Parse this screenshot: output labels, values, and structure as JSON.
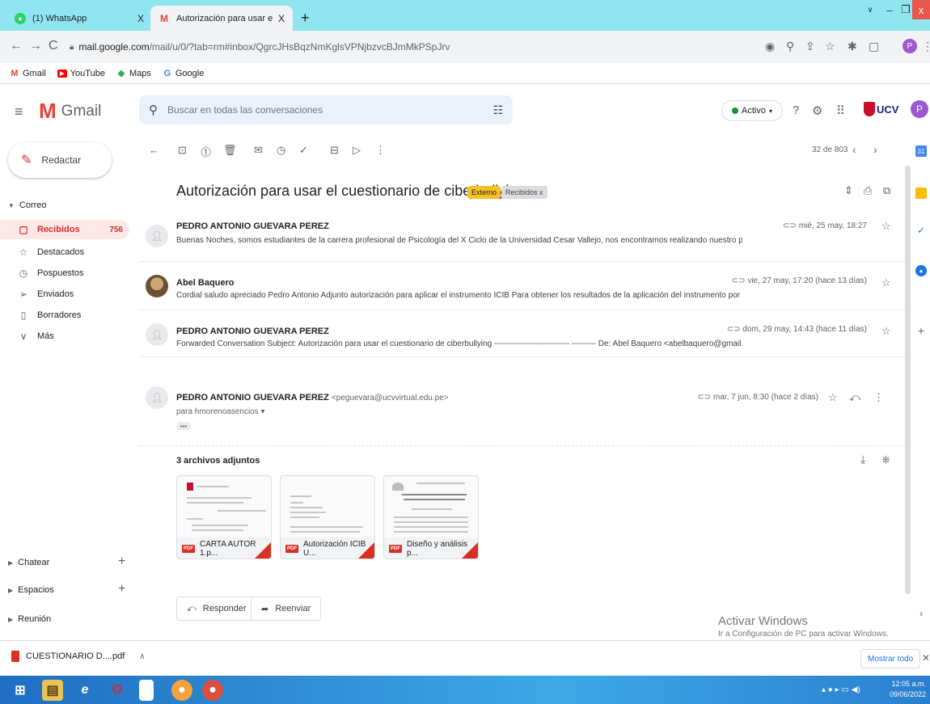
{
  "browser": {
    "tabs": [
      {
        "title": "(1) WhatsApp",
        "icon": "whatsapp-icon",
        "color": "#25d366",
        "glyph": "●"
      },
      {
        "title": "Autorización para usar el cuestion",
        "icon": "gmail-icon",
        "color": "#ea4335",
        "glyph": "M"
      }
    ],
    "new_tab": "+",
    "close_tab": "X",
    "url_host": "mail.google.com",
    "url_path": "/mail/u/0/?tab=rm#inbox/QgrcJHsBqzNmKglsVPNjbzvcBJmMkPSpJrv",
    "profile_initial": "P",
    "bookmarks": [
      {
        "label": "Gmail",
        "icon": "gmail-bookmark-icon",
        "glyph": "M",
        "color": "#ea4335"
      },
      {
        "label": "YouTube",
        "icon": "youtube-bookmark-icon",
        "glyph": "▶",
        "color": "#ff0000"
      },
      {
        "label": "Maps",
        "icon": "maps-bookmark-icon",
        "glyph": "◆",
        "color": "#34a853"
      },
      {
        "label": "Google",
        "icon": "google-bookmark-icon",
        "glyph": "G",
        "color": "#4285f4"
      }
    ]
  },
  "gmail": {
    "app_name": "Gmail",
    "search_placeholder": "Buscar en todas las conversaciones",
    "status": "Activo",
    "profile_initial": "P",
    "org_logo_text": "UCV"
  },
  "sidebar": {
    "compose_label": "Redactar",
    "section_mail": "Correo",
    "items": [
      {
        "label": "Recibidos",
        "count": "756",
        "icon": "inbox-icon",
        "glyph": "▢",
        "active": true
      },
      {
        "label": "Destacados",
        "icon": "star-icon",
        "glyph": "☆"
      },
      {
        "label": "Pospuestos",
        "icon": "clock-icon",
        "glyph": "◷"
      },
      {
        "label": "Enviados",
        "icon": "send-icon",
        "glyph": "➢"
      },
      {
        "label": "Borradores",
        "icon": "draft-icon",
        "glyph": "▯"
      },
      {
        "label": "Más",
        "icon": "chevron-down-icon",
        "glyph": "∨"
      }
    ],
    "section_chat": "Chatear",
    "section_spaces": "Espacios",
    "section_meet": "Reunión"
  },
  "toolbar": {
    "pager": "32 de 803"
  },
  "thread": {
    "subject": "Autorización para usar el cuestionario de ciberbullying",
    "label_external": "Externo",
    "label_inbox": "Recibidos x",
    "messages": [
      {
        "sender": "PEDRO ANTONIO GUEVARA PEREZ",
        "snippet": "Buenas Noches, somos estudiantes de la carrera profesional de Psicología del X Ciclo de la Universidad Cesar Vallejo, nos encontramos realizando nuestro proyect",
        "date": "mié, 25 may, 18:27"
      },
      {
        "sender": "Abel Baquero",
        "snippet": "Cordial saludo apreciado Pedro Antonio Adjunto autorización para aplicar el instrumento ICIB Para obtener los resultados de la aplicación del instrumento por fa",
        "date": "vie, 27 may, 17:20 (hace 13 días)"
      },
      {
        "sender": "PEDRO ANTONIO GUEVARA PEREZ",
        "snippet": "Forwarded Conversation Subject: Autorización para usar el cuestionario de ciberbullying ---------------------------- --------- De: Abel Baquero <abelbaquero@gmail.",
        "date": "dom, 29 may, 14:43 (hace 11 días)"
      },
      {
        "sender": "PEDRO ANTONIO GUEVARA PEREZ",
        "email": "<peguevara@ucvvirtual.edu.pe>",
        "to": "para hmorenoasencios ▾",
        "date": "mar, 7 jun, 8:30 (hace 2 días)"
      }
    ],
    "attachments_header": "3 archivos adjuntos",
    "attachments": [
      {
        "name": "CARTA AUTOR 1.p..."
      },
      {
        "name": "Autorización ICIB U..."
      },
      {
        "name": "Diseño y análisis p..."
      }
    ],
    "reply_label": "Responder",
    "forward_label": "Reenviar"
  },
  "watermark": {
    "line1": "Activar Windows",
    "line2": "Ir a Configuración de PC para activar Windows."
  },
  "downloads": {
    "file": "CUESTIONARIO D....pdf",
    "show_all": "Mostrar todo"
  },
  "taskbar": {
    "time": "12:05 a.m.",
    "date": "09/06/2022"
  }
}
